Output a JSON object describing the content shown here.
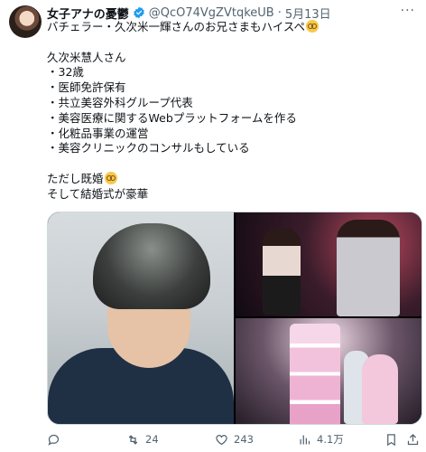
{
  "tweet": {
    "author_name": "女子アナの憂鬱",
    "handle": "@QcO74VgZVtqkeUB",
    "separator": "·",
    "date": "5月13日",
    "more": "···",
    "lines": [
      "バチェラー・久次米一輝さんのお兄さまもハイスペ",
      "",
      "久次米慧人さん",
      "・32歳",
      "・医師免許保有",
      "・共立美容外科グループ代表",
      "・美容医療に関するWebプラットフォームを作る",
      "・化粧品事業の運営",
      "・美容クリニックのコンサルもしている",
      "",
      "ただし既婚",
      "そして結婚式が豪華"
    ]
  },
  "actions": {
    "reply_count": "",
    "retweet_count": "24",
    "like_count": "243",
    "views_count": "4.1万"
  },
  "colors": {
    "text": "#0f1419",
    "muted": "#536471",
    "verified": "#1d9bf0"
  },
  "icons": [
    "verified-badge-icon",
    "more-icon",
    "reply-icon",
    "retweet-icon",
    "like-icon",
    "views-icon",
    "bookmark-icon",
    "share-icon"
  ]
}
